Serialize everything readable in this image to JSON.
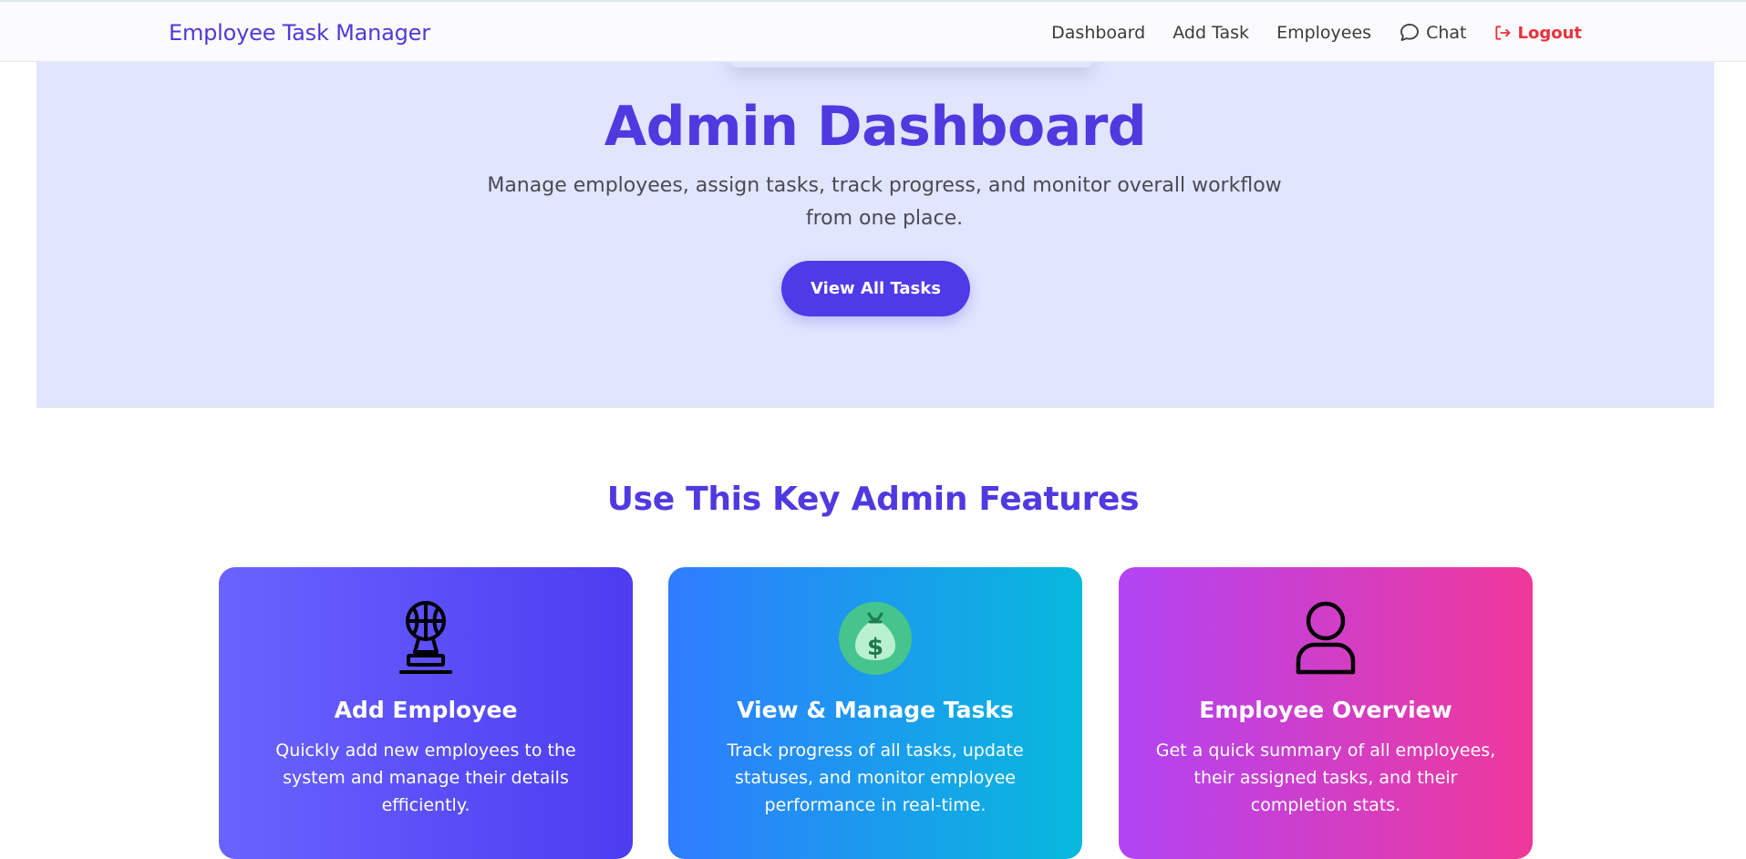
{
  "navbar": {
    "brand": "Employee Task Manager",
    "links": [
      {
        "label": "Dashboard"
      },
      {
        "label": "Add Task"
      },
      {
        "label": "Employees"
      },
      {
        "label": "Chat",
        "icon": "chat-bubble-icon"
      },
      {
        "label": "Logout",
        "icon": "logout-icon",
        "color": "#e8323d"
      }
    ]
  },
  "hero": {
    "title": "Admin Dashboard",
    "subtitle": "Manage employees, assign tasks, track progress, and monitor overall workflow from one place.",
    "button_label": "View All Tasks"
  },
  "features": {
    "title": "Use This Key Admin Features",
    "cards": [
      {
        "icon": "trophy-basketball-icon",
        "title": "Add Employee",
        "description": "Quickly add new employees to the system and manage their details efficiently."
      },
      {
        "icon": "money-bag-icon",
        "title": "View & Manage Tasks",
        "description": "Track progress of all tasks, update statuses, and monitor employee performance in real-time."
      },
      {
        "icon": "user-icon",
        "title": "Employee Overview",
        "description": "Get a quick summary of all employees, their assigned tasks, and their completion stats."
      }
    ]
  },
  "colors": {
    "accent": "#4f3ae8",
    "hero_bg": "#e1e5fd",
    "logout": "#e8323d"
  }
}
